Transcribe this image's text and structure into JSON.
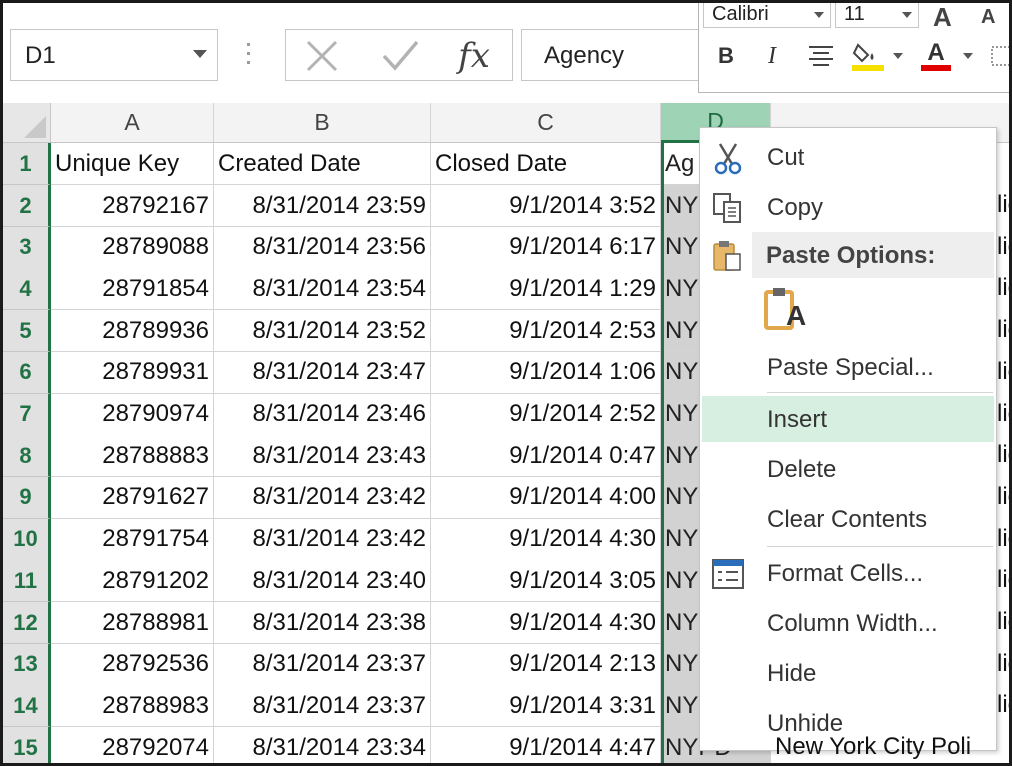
{
  "formula_bar": {
    "name_box": "D1",
    "cancel_glyph": "✕",
    "enter_glyph": "✓",
    "function_glyph": "fx",
    "value": "Agency"
  },
  "mini_toolbar": {
    "font_name": "Calibri",
    "font_size": "11",
    "grow_font": "A",
    "shrink_font": "A",
    "bold": "B",
    "italic": "I",
    "font_color_letter": "A",
    "highlight_color": "#f5e000",
    "font_color": "#e00000"
  },
  "grid": {
    "columns": [
      "A",
      "B",
      "C",
      "D"
    ],
    "selected_column": "D",
    "header_row": {
      "row_number": "1",
      "A": "Unique Key",
      "B": "Created Date",
      "C": "Closed Date",
      "D": "Ag"
    },
    "rows": [
      {
        "n": "2",
        "key": "28792167",
        "created": "8/31/2014 23:59",
        "closed": "9/1/2014 3:52",
        "agency": "NY"
      },
      {
        "n": "3",
        "key": "28789088",
        "created": "8/31/2014 23:56",
        "closed": "9/1/2014 6:17",
        "agency": "NY"
      },
      {
        "n": "4",
        "key": "28791854",
        "created": "8/31/2014 23:54",
        "closed": "9/1/2014 1:29",
        "agency": "NY"
      },
      {
        "n": "5",
        "key": "28789936",
        "created": "8/31/2014 23:52",
        "closed": "9/1/2014 2:53",
        "agency": "NY"
      },
      {
        "n": "6",
        "key": "28789931",
        "created": "8/31/2014 23:47",
        "closed": "9/1/2014 1:06",
        "agency": "NY"
      },
      {
        "n": "7",
        "key": "28790974",
        "created": "8/31/2014 23:46",
        "closed": "9/1/2014 2:52",
        "agency": "NY"
      },
      {
        "n": "8",
        "key": "28788883",
        "created": "8/31/2014 23:43",
        "closed": "9/1/2014 0:47",
        "agency": "NY"
      },
      {
        "n": "9",
        "key": "28791627",
        "created": "8/31/2014 23:42",
        "closed": "9/1/2014 4:00",
        "agency": "NY"
      },
      {
        "n": "10",
        "key": "28791754",
        "created": "8/31/2014 23:42",
        "closed": "9/1/2014 4:30",
        "agency": "NY"
      },
      {
        "n": "11",
        "key": "28791202",
        "created": "8/31/2014 23:40",
        "closed": "9/1/2014 3:05",
        "agency": "NY"
      },
      {
        "n": "12",
        "key": "28788981",
        "created": "8/31/2014 23:38",
        "closed": "9/1/2014 4:30",
        "agency": "NY"
      },
      {
        "n": "13",
        "key": "28792536",
        "created": "8/31/2014 23:37",
        "closed": "9/1/2014 2:13",
        "agency": "NY"
      },
      {
        "n": "14",
        "key": "28788983",
        "created": "8/31/2014 23:37",
        "closed": "9/1/2014 3:31",
        "agency": "NY"
      },
      {
        "n": "15",
        "key": "28792074",
        "created": "8/31/2014 23:34",
        "closed": "9/1/2014 4:47",
        "agency": "NYPD"
      }
    ],
    "right_edge_fragments": [
      "lic",
      "New York City Poli"
    ]
  },
  "context_menu": {
    "cut": "Cut",
    "copy": "Copy",
    "paste_options": "Paste Options:",
    "paste_icon_letter": "A",
    "paste_special": "Paste Special...",
    "insert": "Insert",
    "delete": "Delete",
    "clear_contents": "Clear Contents",
    "format_cells": "Format Cells...",
    "column_width": "Column Width...",
    "hide": "Hide",
    "unhide": "Unhide",
    "highlighted_item": "Insert"
  }
}
